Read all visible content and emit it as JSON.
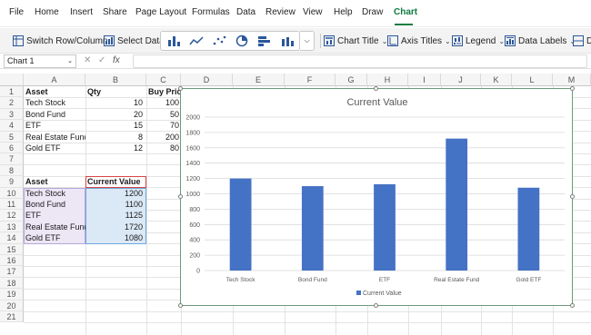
{
  "menu": {
    "items": [
      "File",
      "Home",
      "Insert",
      "Share",
      "Page Layout",
      "Formulas",
      "Data",
      "Review",
      "View",
      "Help",
      "Draw",
      "Chart"
    ],
    "active": "Chart"
  },
  "ribbon": {
    "switch_row_column": "Switch Row/Column",
    "select_data": "Select Data",
    "chart_title": "Chart Title",
    "axis_titles": "Axis Titles",
    "legend": "Legend",
    "data_labels": "Data Labels",
    "truncated": "D"
  },
  "formula_bar": {
    "name_box": "Chart 1",
    "cancel": "✕",
    "enter": "✓",
    "fx": "fx",
    "formula": ""
  },
  "grid": {
    "columns": [
      "A",
      "B",
      "C",
      "D",
      "E",
      "F",
      "G",
      "H",
      "I",
      "J",
      "K",
      "L",
      "M"
    ],
    "rows": [
      "1",
      "2",
      "3",
      "4",
      "5",
      "6",
      "7",
      "8",
      "9",
      "10",
      "11",
      "12",
      "13",
      "14",
      "15",
      "16",
      "17",
      "18",
      "19",
      "20",
      "21"
    ],
    "table1": {
      "headers": [
        "Asset",
        "Qty",
        "Buy Price"
      ],
      "rows": [
        [
          "Tech Stock",
          "10",
          "100"
        ],
        [
          "Bond Fund",
          "20",
          "50"
        ],
        [
          "ETF",
          "15",
          "70"
        ],
        [
          "Real Estate Fund",
          "8",
          "200"
        ],
        [
          "Gold ETF",
          "12",
          "80"
        ]
      ]
    },
    "table2": {
      "headers": [
        "Asset",
        "Current Value"
      ],
      "rows": [
        [
          "Tech Stock",
          "1200"
        ],
        [
          "Bond Fund",
          "1100"
        ],
        [
          "ETF",
          "1125"
        ],
        [
          "Real Estate Fund",
          "1720"
        ],
        [
          "Gold ETF",
          "1080"
        ]
      ]
    }
  },
  "colors": {
    "accent": "#107c41",
    "bar": "#4472c4"
  },
  "chart_data": {
    "type": "bar",
    "title": "Current Value",
    "categories": [
      "Tech Stock",
      "Bond Fund",
      "ETF",
      "Real Estate Fund",
      "Gold ETF"
    ],
    "series": [
      {
        "name": "Current Value",
        "values": [
          1200,
          1100,
          1125,
          1720,
          1080
        ]
      }
    ],
    "ylim": [
      0,
      2000
    ],
    "yticks": [
      0,
      200,
      400,
      600,
      800,
      1000,
      1200,
      1400,
      1600,
      1800,
      2000
    ],
    "grid": true,
    "legend": "bottom",
    "xlabel": "",
    "ylabel": ""
  }
}
